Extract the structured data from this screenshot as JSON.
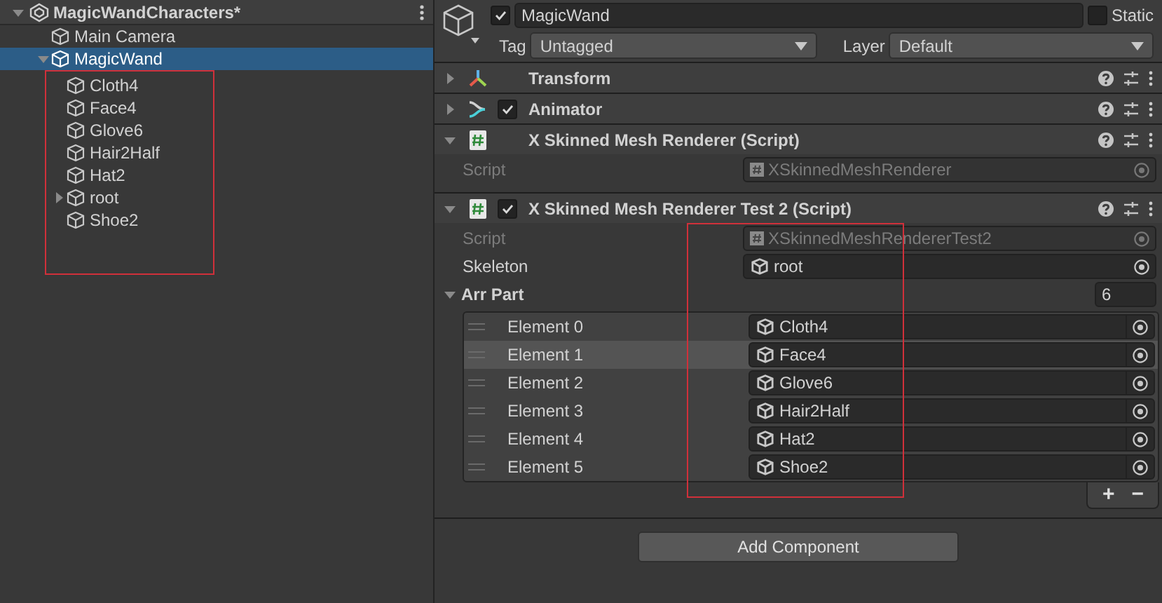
{
  "hierarchy": {
    "scene": {
      "label": "MagicWandCharacters*",
      "expanded": true
    },
    "items": [
      {
        "label": "Main Camera",
        "selected": false
      },
      {
        "label": "MagicWand",
        "selected": true,
        "expanded": true,
        "annotated": true,
        "children": [
          {
            "label": "Cloth4",
            "selected": false
          },
          {
            "label": "Face4",
            "selected": false
          },
          {
            "label": "Glove6",
            "selected": false
          },
          {
            "label": "Hair2Half",
            "selected": false
          },
          {
            "label": "Hat2",
            "selected": false
          },
          {
            "label": "root",
            "selected": false,
            "expanded": false
          },
          {
            "label": "Shoe2",
            "selected": false
          }
        ]
      }
    ]
  },
  "inspector": {
    "active": true,
    "object_name": "MagicWand",
    "static": {
      "label": "Static",
      "checked": false
    },
    "tag": {
      "label": "Tag",
      "value": "Untagged"
    },
    "layer": {
      "label": "Layer",
      "value": "Default"
    },
    "components": [
      {
        "kind": "transform",
        "title": "Transform",
        "expanded": false
      },
      {
        "kind": "animator",
        "title": "Animator",
        "enabled": true,
        "expanded": false
      },
      {
        "kind": "script",
        "title": "X Skinned Mesh Renderer (Script)",
        "expanded": true,
        "fields": [
          {
            "kind": "script",
            "label": "Script",
            "value": "XSkinnedMeshRenderer",
            "disabled": true
          }
        ]
      },
      {
        "kind": "script",
        "title": "X Skinned Mesh Renderer Test 2 (Script)",
        "enabled": true,
        "expanded": true,
        "fields": [
          {
            "kind": "script",
            "label": "Script",
            "value": "XSkinnedMeshRendererTest2",
            "disabled": true
          },
          {
            "kind": "object",
            "label": "Skeleton",
            "value": "root"
          },
          {
            "kind": "list",
            "label": "Arr Part",
            "expanded": true,
            "size": "6",
            "annotated": true,
            "buttons": [
              "+",
              "−"
            ],
            "elements": [
              {
                "label": "Element 0",
                "value": "Cloth4",
                "selected": false
              },
              {
                "label": "Element 1",
                "value": "Face4",
                "selected": true
              },
              {
                "label": "Element 2",
                "value": "Glove6",
                "selected": false
              },
              {
                "label": "Element 3",
                "value": "Hair2Half",
                "selected": false
              },
              {
                "label": "Element 4",
                "value": "Hat2",
                "selected": false
              },
              {
                "label": "Element 5",
                "value": "Shoe2",
                "selected": false
              }
            ]
          }
        ]
      }
    ],
    "add_button": "Add Component"
  }
}
